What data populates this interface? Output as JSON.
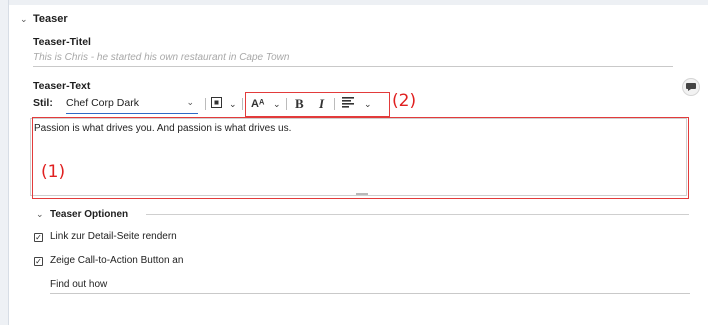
{
  "teaser": {
    "section_title": "Teaser",
    "title_label": "Teaser-Titel",
    "title_placeholder": "This is Chris - he started his own restaurant in Cape Town",
    "text_label": "Teaser-Text",
    "style_label": "Stil:",
    "style_value": "Chef Corp Dark",
    "editor_text": "Passion is what drives you. And passion is what drives us."
  },
  "toolbar": {
    "font_size_glyph": "Aᴬ",
    "bold": "B",
    "italic": "I"
  },
  "annotations": {
    "editor_marker": "(1)",
    "toolbar_marker": "(2)",
    "color": "#e02020"
  },
  "options": {
    "section_title": "Teaser Optionen",
    "link_label": "Link zur Detail-Seite rendern",
    "cta_label": "Zeige Call-to-Action Button an",
    "cta_text": "Find out how"
  },
  "colors": {
    "accent": "#2e6ac6",
    "marker": "#e23b3b"
  }
}
